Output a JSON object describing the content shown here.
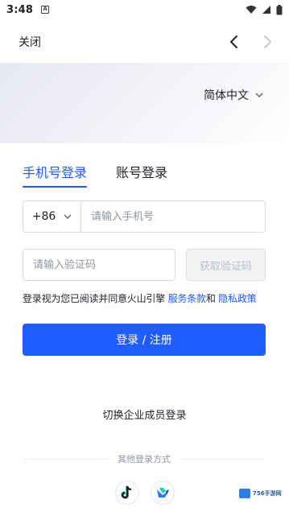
{
  "status_bar": {
    "time": "3:48"
  },
  "titlebar": {
    "close_label": "关闭"
  },
  "language": {
    "selected": "简体中文"
  },
  "tabs": [
    {
      "label": "手机号登录",
      "active": true
    },
    {
      "label": "账号登录",
      "active": false
    }
  ],
  "phone": {
    "country_code": "+86",
    "placeholder": "请输入手机号",
    "value": ""
  },
  "verification": {
    "placeholder": "请输入验证码",
    "value": "",
    "get_code_label": "获取验证码"
  },
  "agreement": {
    "prefix": "登录视为您已阅读并同意火山引擎 ",
    "terms_link": "服务条款",
    "conjunction": "和 ",
    "privacy_link": "隐私政策"
  },
  "login_button": "登录 / 注册",
  "switch_enterprise": "切换企业成员登录",
  "other_methods_label": "其他登录方式",
  "social_icons": [
    "douyin-icon",
    "feishu-icon"
  ],
  "watermark": {
    "text": "756手游网"
  },
  "colors": {
    "accent": "#1f5dff",
    "disabled_text": "#bbbfc4",
    "border": "#d9dbe0"
  }
}
